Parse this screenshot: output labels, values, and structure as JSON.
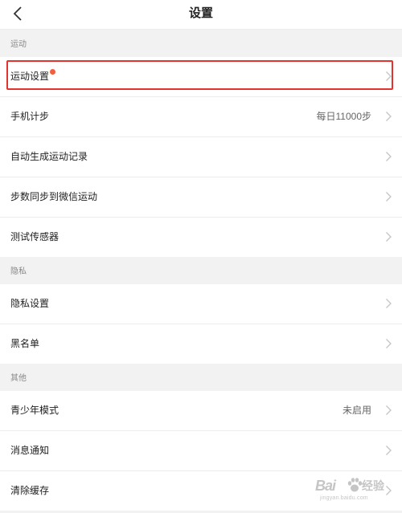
{
  "header": {
    "title": "设置",
    "back_icon": "chevron-left-icon"
  },
  "sections": [
    {
      "title": "运动",
      "items": [
        {
          "label": "运动设置",
          "value": "",
          "has_dot": true
        },
        {
          "label": "手机计步",
          "value": "每日11000步"
        },
        {
          "label": "自动生成运动记录",
          "value": ""
        },
        {
          "label": "步数同步到微信运动",
          "value": ""
        },
        {
          "label": "测试传感器",
          "value": ""
        }
      ]
    },
    {
      "title": "隐私",
      "items": [
        {
          "label": "隐私设置",
          "value": ""
        },
        {
          "label": "黑名单",
          "value": ""
        }
      ]
    },
    {
      "title": "其他",
      "items": [
        {
          "label": "青少年模式",
          "value": "未启用"
        },
        {
          "label": "消息通知",
          "value": ""
        },
        {
          "label": "清除缓存",
          "value": ""
        }
      ]
    }
  ],
  "colors": {
    "highlight": "#e0342f",
    "dot": "#f0603f",
    "background": "#f2f2f2"
  },
  "watermark": {
    "logo": "Bai",
    "suffix": "经验",
    "url": "jingyan.baidu.com"
  }
}
